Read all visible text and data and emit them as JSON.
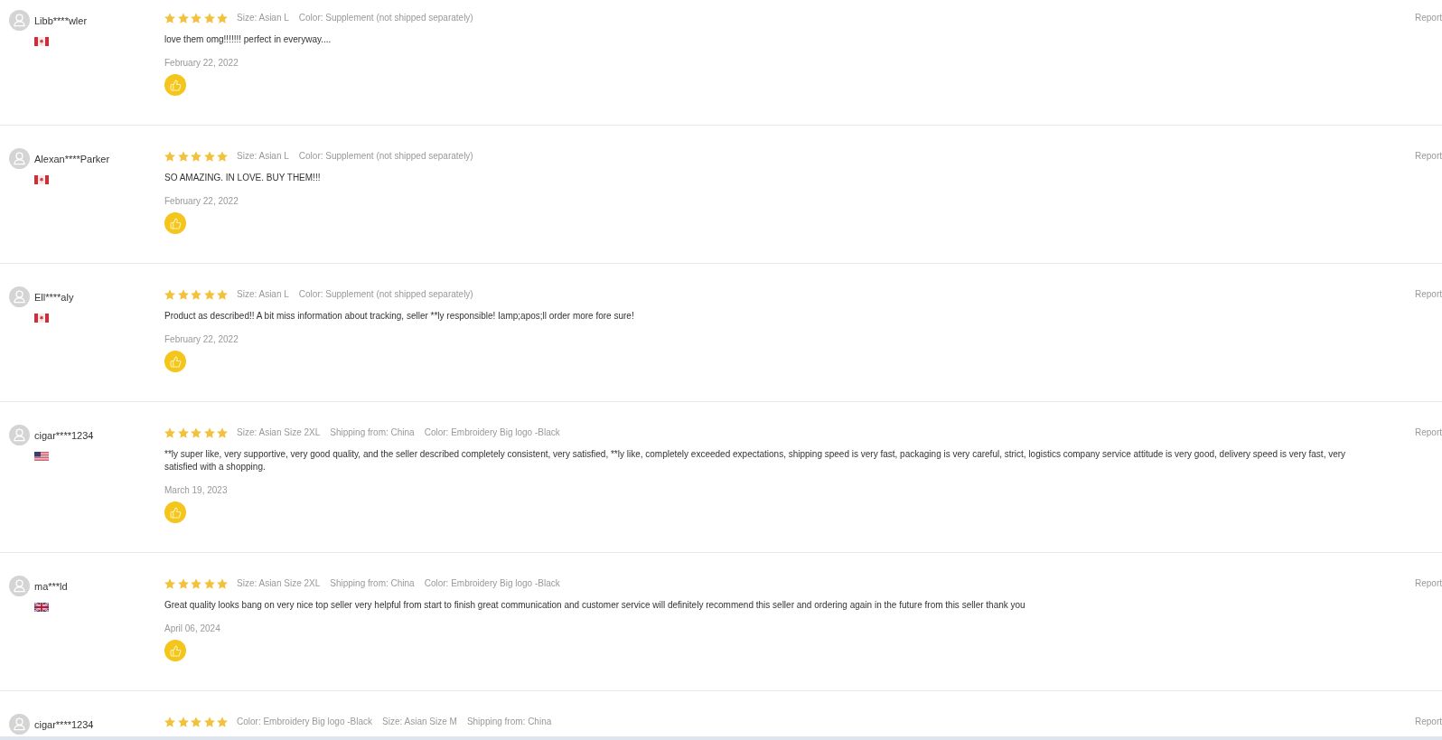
{
  "reviews": [
    {
      "user": "Libb****wler",
      "flag": {
        "kind": "canada"
      },
      "stars": 5,
      "attributes": [
        "Size: Asian L",
        "Color: Supplement (not shipped separately)"
      ],
      "text": "love them omg!!!!!!! perfect in everyway....",
      "date": "February 22, 2022",
      "report": "Report"
    },
    {
      "user": "Alexan****Parker",
      "flag": {
        "kind": "canada"
      },
      "stars": 5,
      "attributes": [
        "Size: Asian L",
        "Color: Supplement (not shipped separately)"
      ],
      "text": "SO AMAZING. IN LOVE. BUY THEM!!!",
      "date": "February 22, 2022",
      "report": "Report"
    },
    {
      "user": "Ell****aly",
      "flag": {
        "kind": "canada"
      },
      "stars": 5,
      "attributes": [
        "Size: Asian L",
        "Color: Supplement (not shipped separately)"
      ],
      "text": "Product as described!! A bit miss information about tracking, seller **ly responsible! Iamp;apos;ll order more fore sure!",
      "date": "February 22, 2022",
      "report": "Report"
    },
    {
      "user": "cigar****1234",
      "flag": {
        "kind": "usa"
      },
      "stars": 5,
      "attributes": [
        "Size: Asian Size 2XL",
        "Shipping from: China",
        "Color: Embroidery Big logo -Black"
      ],
      "text": "**ly super like, very supportive, very good quality, and the seller described completely consistent, very satisfied, **ly like, completely exceeded expectations, shipping speed is very fast, packaging is very careful, strict, logistics company service attitude is very good, delivery speed is very fast, very satisfied with a shopping.",
      "date": "March 19, 2023",
      "report": "Report"
    },
    {
      "user": "ma***ld",
      "flag": {
        "kind": "uk"
      },
      "stars": 5,
      "attributes": [
        "Size: Asian Size 2XL",
        "Shipping from: China",
        "Color: Embroidery Big logo -Black"
      ],
      "text": "Great quality looks bang on very nice top seller very helpful from start to finish great communication and customer service will definitely recommend this seller and ordering again in the future from this seller thank you",
      "date": "April 06, 2024",
      "report": "Report"
    },
    {
      "user": "cigar****1234",
      "stars": 5,
      "attributes": [
        "Color: Embroidery Big logo -Black",
        "Size: Asian Size M",
        "Shipping from: China"
      ],
      "report": "Report"
    }
  ]
}
